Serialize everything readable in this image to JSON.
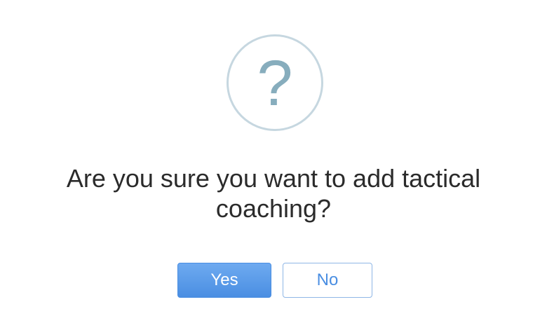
{
  "dialog": {
    "icon": "question-mark-icon",
    "icon_glyph": "?",
    "message": "Are you sure you want to add tactical coaching?",
    "yes_label": "Yes",
    "no_label": "No"
  },
  "colors": {
    "icon_ring": "#c6d7e0",
    "icon_glyph": "#87adbd",
    "primary_button": "#4a8ee2",
    "text": "#2b2b2b"
  }
}
